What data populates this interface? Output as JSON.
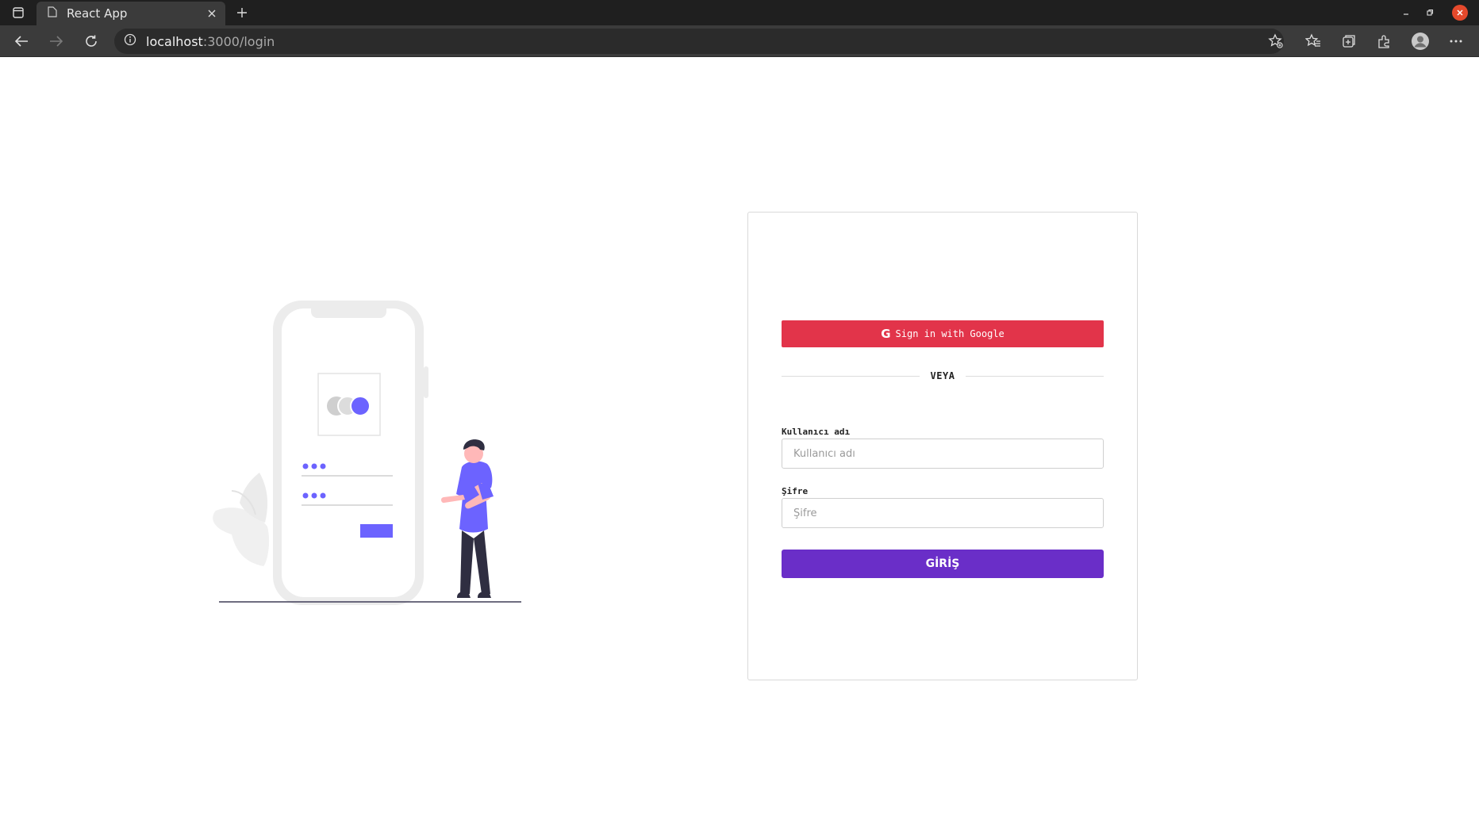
{
  "browser": {
    "tab_title": "React App",
    "url_host": "localhost",
    "url_path": ":3000/login"
  },
  "login": {
    "google_label": "Sign in with Google",
    "divider_text": "VEYA",
    "username_label": "Kullanıcı adı",
    "username_placeholder": "Kullanıcı adı",
    "username_value": "",
    "password_label": "Şifre",
    "password_placeholder": "Şifre",
    "password_value": "",
    "submit_label": "GİRİŞ"
  },
  "colors": {
    "google_button": "#e2344a",
    "submit_button": "#6a2ec8",
    "illustration_accent": "#6c63ff"
  },
  "icons": {
    "google": "google-g-icon",
    "back": "arrow-left-icon",
    "forward": "arrow-right-icon",
    "reload": "reload-icon",
    "info": "info-icon"
  }
}
